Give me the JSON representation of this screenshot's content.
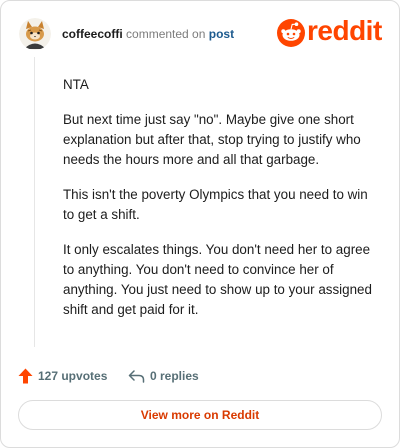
{
  "comment": {
    "author": "coffeecoffi",
    "action_text": "commented on",
    "target_link": "post",
    "paragraphs": [
      "NTA",
      "But next time just say \"no\". Maybe give one short explanation but after that, stop trying to justify who needs the hours more and all that garbage.",
      "This isn't the poverty Olympics that you need to win to get a shift.",
      "It only escalates things. You don't need her to agree to anything. You don't need to convince her of anything. You just need to show up to your assigned shift and get paid for it."
    ]
  },
  "brand": {
    "logo_text": "reddit",
    "accent_color": "#ff4500"
  },
  "stats": {
    "upvotes_label": "127 upvotes",
    "replies_label": "0 replies"
  },
  "cta": {
    "label": "View more on Reddit",
    "color": "#d93a00"
  },
  "icons": {
    "avatar": "snoo-avatar",
    "logo": "reddit-snoo-icon",
    "upvote": "upvote-arrow-icon",
    "reply": "reply-arrow-icon"
  }
}
